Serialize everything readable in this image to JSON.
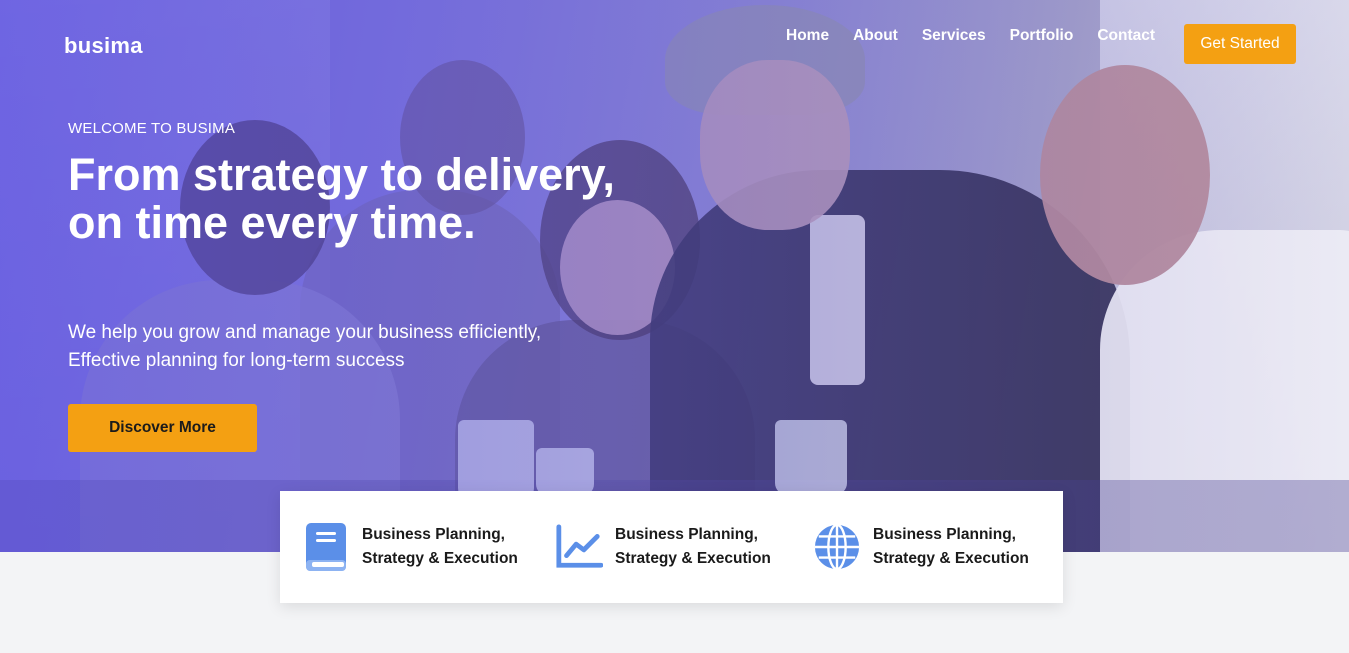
{
  "brand": {
    "logo_text": "busima"
  },
  "nav": {
    "items": [
      {
        "label": "Home"
      },
      {
        "label": "About"
      },
      {
        "label": "Services"
      },
      {
        "label": "Portfolio"
      },
      {
        "label": "Contact"
      }
    ],
    "cta_label": "Get Started"
  },
  "hero": {
    "eyebrow": "WELCOME TO BUSIMA",
    "headline": "From strategy to delivery, on time every time.",
    "subtext_line1": "We help you grow and manage your business efficiently,",
    "subtext_line2": "Effective planning for long-term success",
    "button_label": "Discover More"
  },
  "features": [
    {
      "icon": "book-icon",
      "line1": "Business Planning,",
      "line2": "Strategy & Execution"
    },
    {
      "icon": "line-chart-icon",
      "line1": "Business Planning,",
      "line2": "Strategy & Execution"
    },
    {
      "icon": "globe-icon",
      "line1": "Business Planning,",
      "line2": "Strategy & Execution"
    }
  ],
  "colors": {
    "accent": "#f4a012",
    "hero_tint": "#6d63d9",
    "icon_blue": "#5b8fe8",
    "page_bg": "#f3f4f6"
  }
}
